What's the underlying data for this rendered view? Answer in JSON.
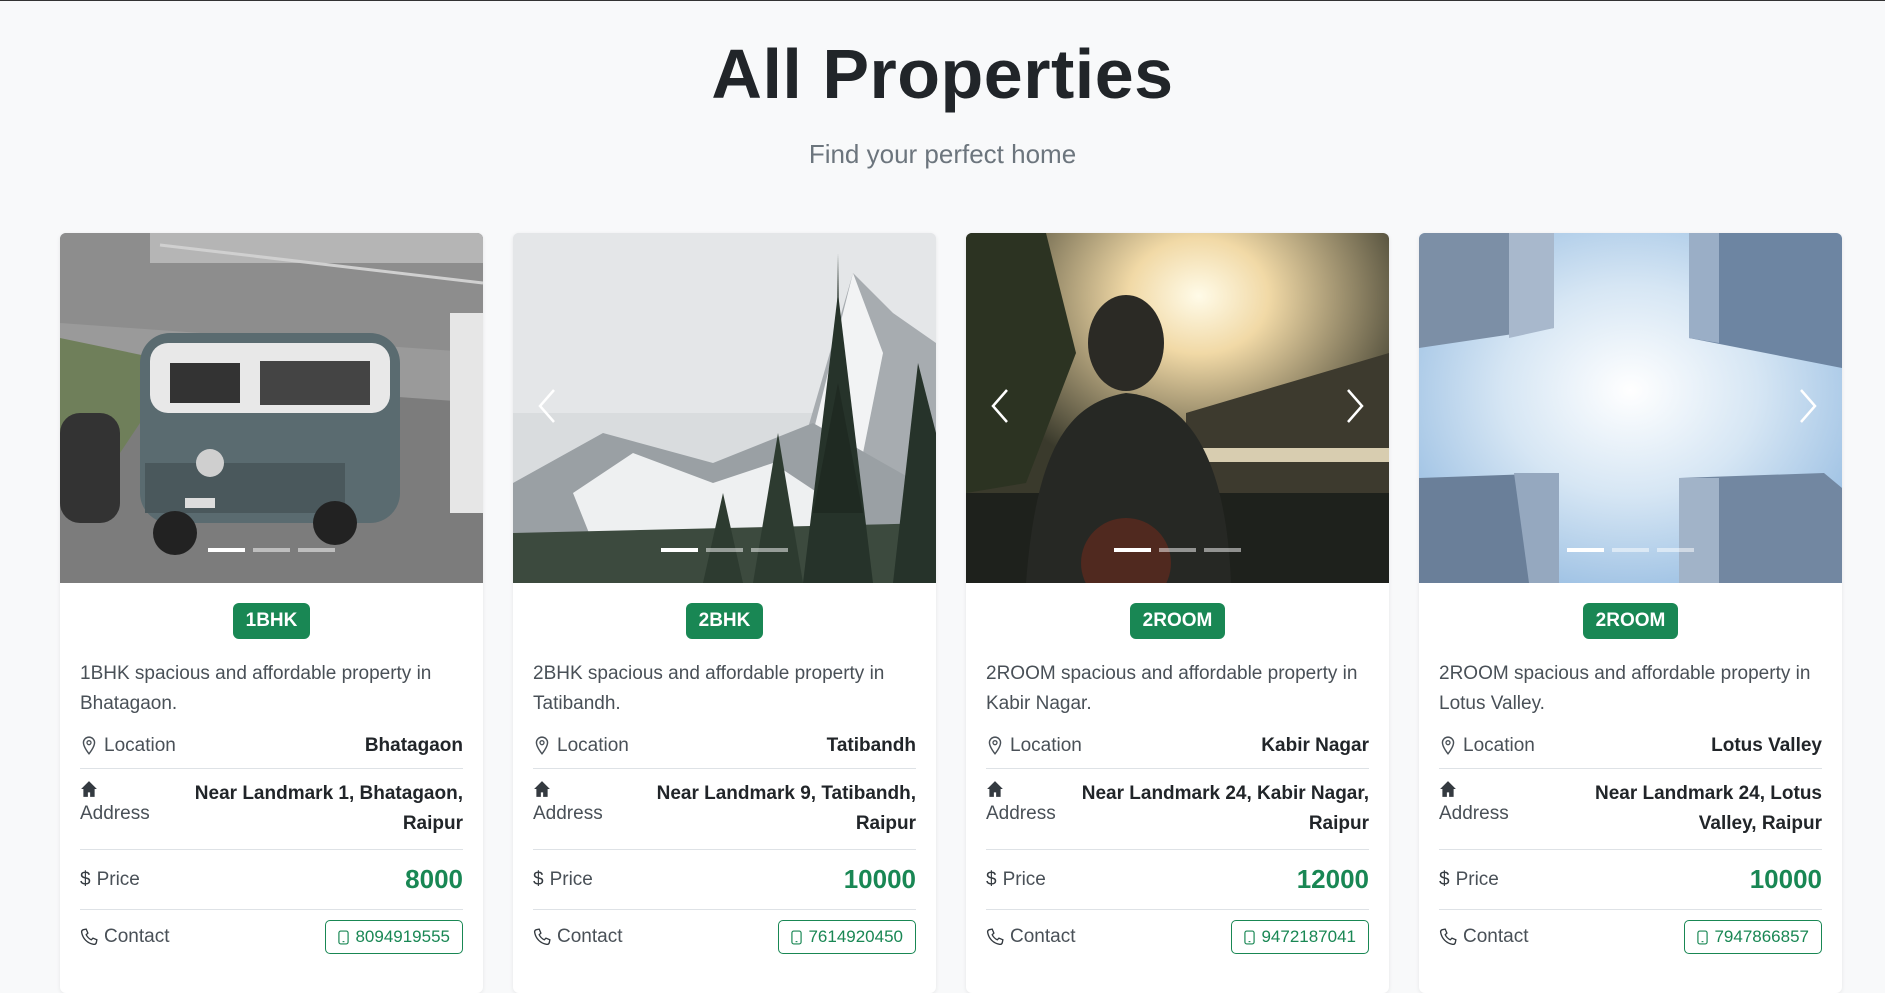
{
  "header": {
    "title": "All Properties",
    "subtitle": "Find your perfect home"
  },
  "labels": {
    "location": "Location",
    "address": "Address",
    "price": "Price",
    "contact": "Contact"
  },
  "properties": [
    {
      "type": "1BHK",
      "description": "1BHK spacious and affordable property in Bhatagaon.",
      "location": "Bhatagaon",
      "address": "Near Landmark 1, Bhatagaon, Raipur",
      "price": "8000",
      "phone": "8094919555",
      "image": "van-photo",
      "slides": 3,
      "active_slide": 1,
      "arrows": "none"
    },
    {
      "type": "2BHK",
      "description": "2BHK spacious and affordable property in Tatibandh.",
      "location": "Tatibandh",
      "address": "Near Landmark 9, Tatibandh, Raipur",
      "price": "10000",
      "phone": "7614920450",
      "image": "snowy-mountain-photo",
      "slides": 3,
      "active_slide": 1,
      "arrows": "prev"
    },
    {
      "type": "2ROOM",
      "description": "2ROOM spacious and affordable property in Kabir Nagar.",
      "location": "Kabir Nagar",
      "address": "Near Landmark 24, Kabir Nagar, Raipur",
      "price": "12000",
      "phone": "9472187041",
      "image": "sunset-person-photo",
      "slides": 3,
      "active_slide": 1,
      "arrows": "both"
    },
    {
      "type": "2ROOM",
      "description": "2ROOM spacious and affordable property in Lotus Valley.",
      "location": "Lotus Valley",
      "address": "Near Landmark 24, Lotus Valley, Raipur",
      "price": "10000",
      "phone": "7947866857",
      "image": "sky-buildings-photo",
      "slides": 3,
      "active_slide": 1,
      "arrows": "next"
    }
  ],
  "colors": {
    "accent": "#198754",
    "background": "#f8f9fa",
    "text": "#212529"
  },
  "icons": {
    "location": "geo-pin-icon",
    "address": "house-icon",
    "price": "dollar-icon",
    "contact": "telephone-icon",
    "phone_button": "phone-icon",
    "carousel_prev": "chevron-left-icon",
    "carousel_next": "chevron-right-icon"
  }
}
